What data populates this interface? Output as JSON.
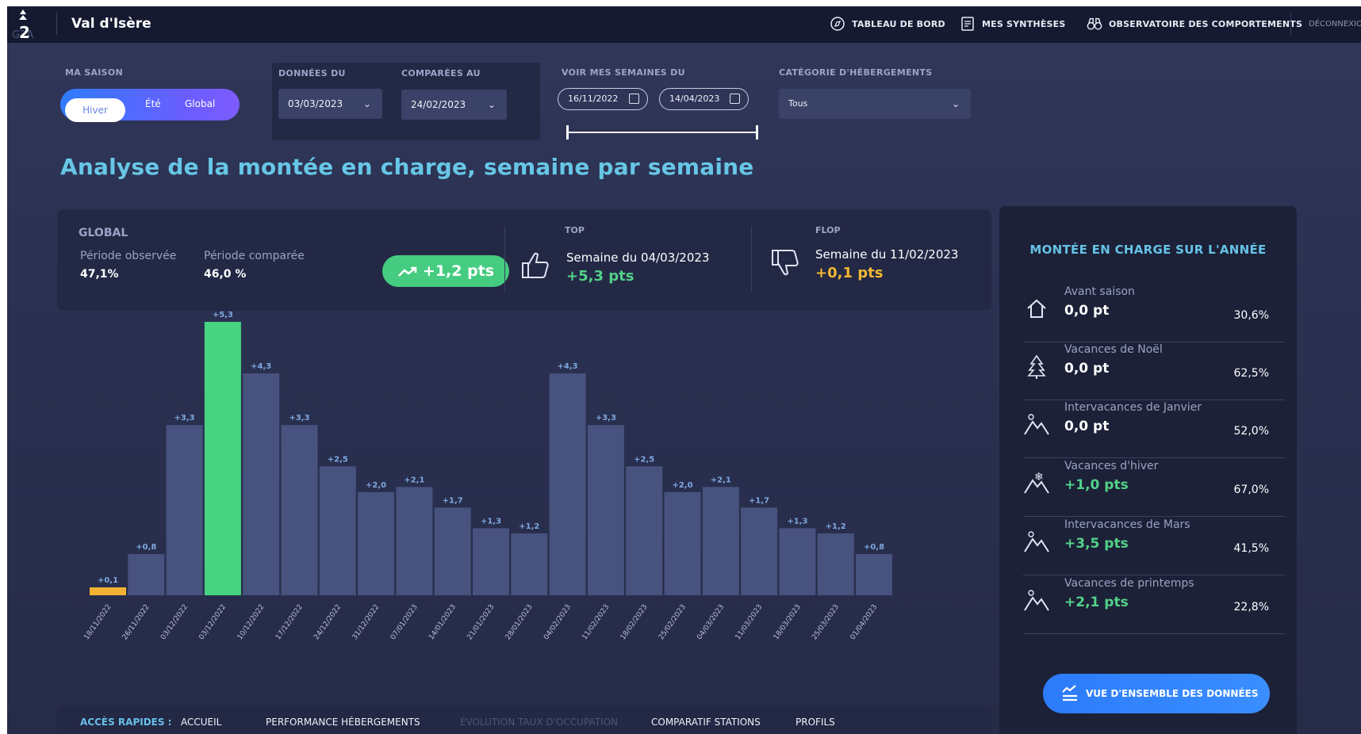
{
  "header": {
    "logo_text": "G2A",
    "title": "Val d'Isère",
    "nav": [
      {
        "label": "TABLEAU DE BORD",
        "icon": "compass-icon"
      },
      {
        "label": "MES SYNTHÈSES",
        "icon": "document-icon"
      },
      {
        "label": "OBSERVATOIRE DES COMPORTEMENTS",
        "icon": "binoculars-icon"
      }
    ],
    "logout_label": "DÉCONNEXION"
  },
  "filters": {
    "season": {
      "label": "MA SAISON",
      "options": [
        "Hiver",
        "Été",
        "Global"
      ],
      "selected": "Hiver"
    },
    "donnees_du": {
      "label": "DONNÉES DU",
      "value": "03/03/2023"
    },
    "comparees_au": {
      "label": "COMPARÉES AU",
      "value": "24/02/2023"
    },
    "weeks": {
      "label": "VOIR MES SEMAINES DU",
      "from": "16/11/2022",
      "to": "14/04/2023"
    },
    "accommodation": {
      "label": "CATÉGORIE D'HÉBERGEMENTS",
      "value": "Tous"
    }
  },
  "page_title": "Analyse de la montée en charge, semaine par semaine",
  "kpi": {
    "global_label": "GLOBAL",
    "observed_label": "Période observée",
    "observed_value": "47,1%",
    "compared_label": "Période comparée",
    "compared_value": "46,0 %",
    "delta": "+1,2 pts",
    "top_label": "TOP",
    "top_week": "Semaine du 04/03/2023",
    "top_value": "+5,3 pts",
    "flop_label": "FLOP",
    "flop_week": "Semaine du 11/02/2023",
    "flop_value": "+0,1 pts"
  },
  "chart_data": {
    "type": "bar",
    "categories": [
      "18/11/2022",
      "26/11/2022",
      "03/12/2022",
      "03/12/2022",
      "10/12/2022",
      "17/12/2022",
      "24/12/2022",
      "31/12/2022",
      "07/01/2023",
      "14/01/2023",
      "21/01/2023",
      "28/01/2023",
      "04/02/2023",
      "11/02/2023",
      "18/02/2023",
      "25/02/2023",
      "04/03/2023",
      "11/03/2023",
      "18/03/2023",
      "25/03/2023",
      "01/04/2023"
    ],
    "values": [
      0.1,
      0.8,
      3.3,
      5.3,
      4.3,
      3.3,
      2.5,
      2.0,
      2.1,
      1.7,
      1.3,
      1.2,
      4.3,
      3.3,
      2.5,
      2.0,
      2.1,
      1.7,
      1.3,
      1.2,
      0.8
    ],
    "labels": [
      "+0,1",
      "+0,8",
      "+3,3",
      "+5,3",
      "+4,3",
      "+3,3",
      "+2,5",
      "+2,0",
      "+2,1",
      "+1,7",
      "+1,3",
      "+1,2",
      "+4,3",
      "+3,3",
      "+2,5",
      "+2,0",
      "+2,1",
      "+1,7",
      "+1,3",
      "+1,2",
      "+0,8"
    ],
    "highlight_max_index": 3,
    "highlight_min_index": 0,
    "ylim": [
      0,
      5.5
    ],
    "colors": {
      "default": "#47527e",
      "max": "#47d482",
      "min": "#f2b334"
    }
  },
  "year_panel": {
    "title": "MONTÉE EN CHARGE SUR L'ANNÉE",
    "items": [
      {
        "name": "Avant saison",
        "value": "0,0 pt",
        "percent": "30,6%",
        "icon": "house-icon",
        "color": "#ffffff"
      },
      {
        "name": "Vacances de Noël",
        "value": "0,0 pt",
        "percent": "62,5%",
        "icon": "christmas-tree-icon",
        "color": "#ffffff"
      },
      {
        "name": "Intervacances de Janvier",
        "value": "0,0 pt",
        "percent": "52,0%",
        "icon": "mountain-sun-icon",
        "color": "#ffffff"
      },
      {
        "name": "Vacances d'hiver",
        "value": "+1,0 pts",
        "percent": "67,0%",
        "icon": "mountain-snow-icon",
        "color": "#52d188"
      },
      {
        "name": "Intervacances de Mars",
        "value": "+3,5 pts",
        "percent": "41,5%",
        "icon": "mountain-sun-icon",
        "color": "#52d188"
      },
      {
        "name": "Vacances de printemps",
        "value": "+2,1 pts",
        "percent": "22,8%",
        "icon": "mountain-sun-icon",
        "color": "#52d188"
      }
    ],
    "button_label": "VUE D'ENSEMBLE DES DONNÉES"
  },
  "quick_links": {
    "label": "ACCÈS RAPIDES :",
    "items": [
      "ACCUEIL",
      "PERFORMANCE HÉBERGEMENTS",
      "ÉVOLUTION TAUX D'OCCUPATION",
      "COMPARATIF STATIONS",
      "PROFILS"
    ]
  }
}
